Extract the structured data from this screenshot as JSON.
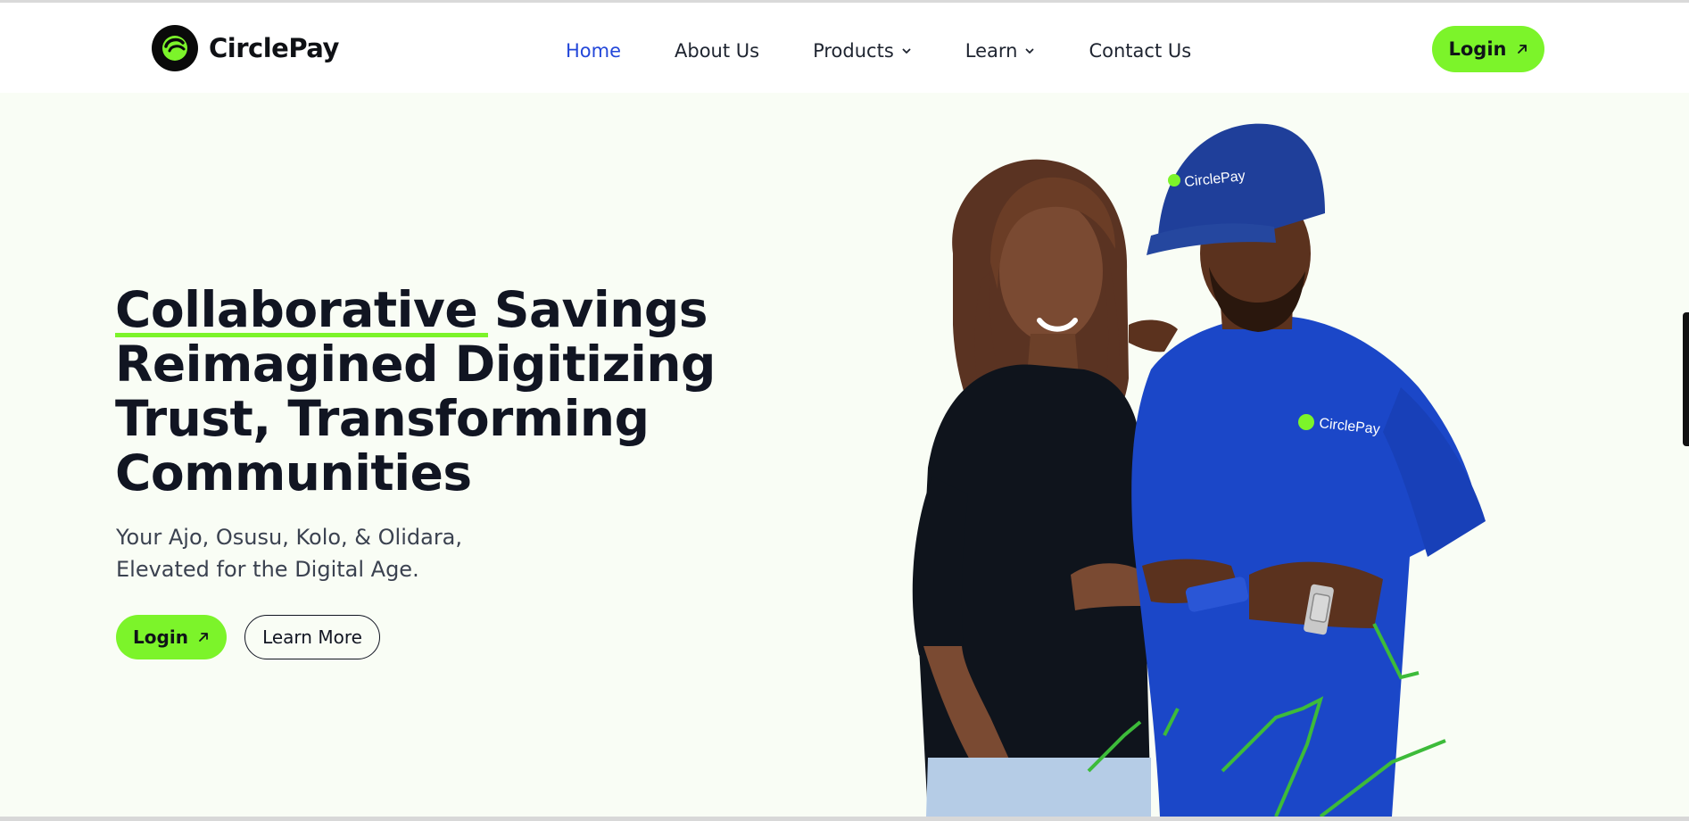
{
  "brand": {
    "name": "CirclePay",
    "logo_icon": "circlepay-logo-icon",
    "accent": "#7cf42a"
  },
  "nav": {
    "items": [
      {
        "label": "Home",
        "active": true,
        "has_dropdown": false
      },
      {
        "label": "About Us",
        "active": false,
        "has_dropdown": false
      },
      {
        "label": "Products",
        "active": false,
        "has_dropdown": true
      },
      {
        "label": "Learn",
        "active": false,
        "has_dropdown": true
      },
      {
        "label": "Contact Us",
        "active": false,
        "has_dropdown": false
      }
    ],
    "login_label": "Login",
    "active_color": "#2347d9"
  },
  "hero": {
    "title_highlight": "Collaborative",
    "title_rest_line1": "Savings",
    "title_line2": "Reimagined Digitizing",
    "title_line3": "Trust, Transforming",
    "title_line4": "Communities",
    "subtitle_line1": "Your Ajo, Osusu, Kolo, & Olidara,",
    "subtitle_line2": "Elevated for the Digital Age.",
    "login_label": "Login",
    "learn_more_label": "Learn More",
    "image_cap_text": "CirclePay",
    "image_shirt_text": "CirclePay"
  }
}
